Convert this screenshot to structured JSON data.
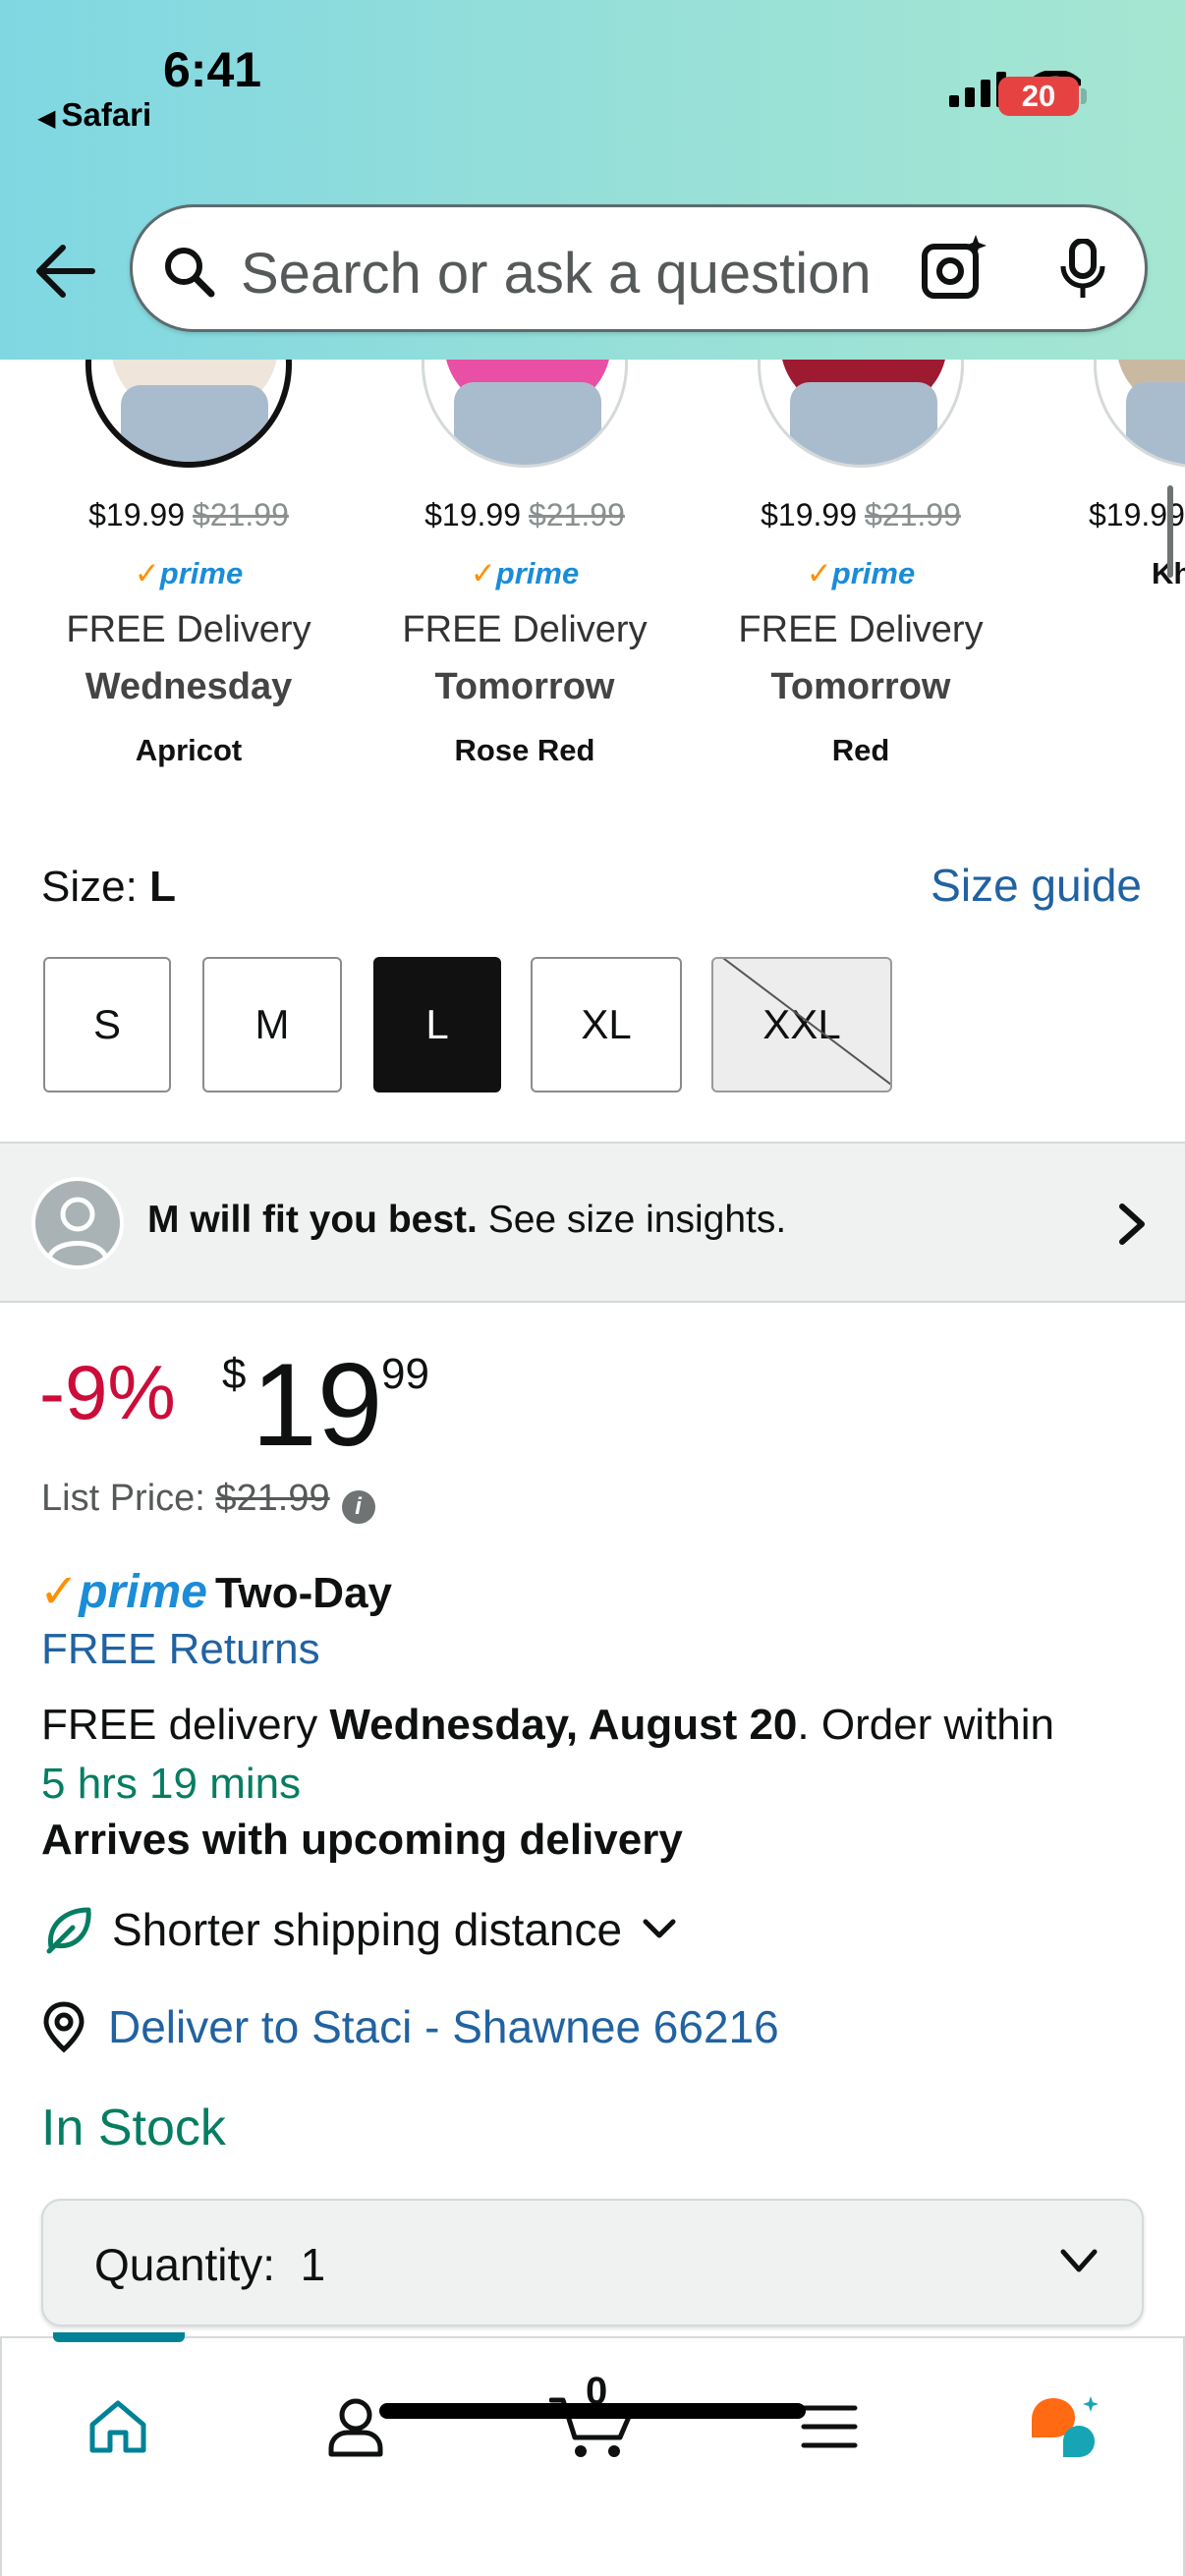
{
  "status_bar": {
    "time": "6:41",
    "back_app": "Safari",
    "battery": "20"
  },
  "search": {
    "placeholder": "Search or ask a question"
  },
  "variants": [
    {
      "price": "$19.99",
      "old_price": "$21.99",
      "prime": "prime",
      "delivery": "FREE Delivery",
      "day": "Wednesday",
      "color": "Apricot",
      "shirt_color": "#efe5da",
      "selected": true
    },
    {
      "price": "$19.99",
      "old_price": "$21.99",
      "prime": "prime",
      "delivery": "FREE Delivery",
      "day": "Tomorrow",
      "color": "Rose Red",
      "shirt_color": "#e94fa4",
      "selected": false
    },
    {
      "price": "$19.99",
      "old_price": "$21.99",
      "prime": "prime",
      "delivery": "FREE Delivery",
      "day": "Tomorrow",
      "color": "Red",
      "shirt_color": "#9e1a31",
      "selected": false
    },
    {
      "price": "$19.99",
      "color": "Kh",
      "shirt_color": "#c9b9a0",
      "selected": false
    }
  ],
  "size": {
    "label": "Size:",
    "selected": "L",
    "guide_link": "Size guide",
    "options": [
      "S",
      "M",
      "L",
      "XL",
      "XXL"
    ]
  },
  "insights": {
    "bold": "M will fit you best.",
    "rest": "See size insights."
  },
  "pricing": {
    "discount": "-9%",
    "currency": "$",
    "whole": "19",
    "fraction": "99",
    "list_label": "List Price:",
    "list_price": "$21.99"
  },
  "shipping": {
    "prime_label": "prime",
    "prime_type": "Two-Day",
    "free_returns": "FREE Returns",
    "delivery_prefix": "FREE delivery",
    "delivery_date": "Wednesday, August 20",
    "order_within": ". Order within",
    "countdown": "5 hrs 19 mins",
    "arrives": "Arrives with upcoming delivery",
    "shorter": "Shorter shipping distance",
    "deliver_to": "Deliver to Staci - Shawnee 66216",
    "stock": "In Stock"
  },
  "quantity": {
    "label": "Quantity:",
    "value": "1"
  },
  "nav": {
    "cart_count": "0"
  },
  "colors": {
    "link": "#2162a1",
    "deal_red": "#cc0c39",
    "stock_green": "#067d62",
    "prime_blue": "#1a8cd8",
    "nav_teal": "#008296"
  }
}
